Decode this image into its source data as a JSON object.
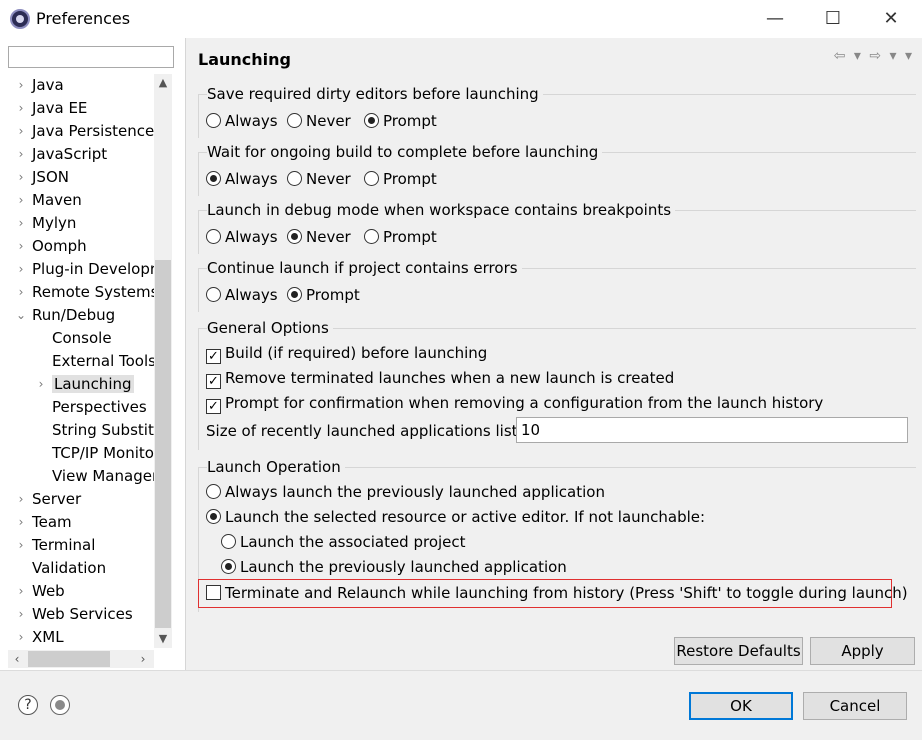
{
  "window": {
    "title": "Preferences",
    "minimize": "—",
    "maximize": "☐",
    "close": "✕"
  },
  "sidebar": {
    "filter_value": "",
    "items": [
      {
        "label": "Java",
        "arrow": "›"
      },
      {
        "label": "Java EE",
        "arrow": "›"
      },
      {
        "label": "Java Persistence",
        "arrow": "›"
      },
      {
        "label": "JavaScript",
        "arrow": "›"
      },
      {
        "label": "JSON",
        "arrow": "›"
      },
      {
        "label": "Maven",
        "arrow": "›"
      },
      {
        "label": "Mylyn",
        "arrow": "›"
      },
      {
        "label": "Oomph",
        "arrow": "›"
      },
      {
        "label": "Plug-in Developr",
        "arrow": "›"
      },
      {
        "label": "Remote Systems",
        "arrow": "›"
      },
      {
        "label": "Run/Debug",
        "arrow": "⌄"
      },
      {
        "label": "Console",
        "arrow": ""
      },
      {
        "label": "External Tools",
        "arrow": ""
      },
      {
        "label": "Launching",
        "arrow": "›"
      },
      {
        "label": "Perspectives",
        "arrow": ""
      },
      {
        "label": "String Substitu",
        "arrow": ""
      },
      {
        "label": "TCP/IP Monito",
        "arrow": ""
      },
      {
        "label": "View Manager",
        "arrow": ""
      },
      {
        "label": "Server",
        "arrow": "›"
      },
      {
        "label": "Team",
        "arrow": "›"
      },
      {
        "label": "Terminal",
        "arrow": "›"
      },
      {
        "label": "Validation",
        "arrow": ""
      },
      {
        "label": "Web",
        "arrow": "›"
      },
      {
        "label": "Web Services",
        "arrow": "›"
      },
      {
        "label": "XML",
        "arrow": "›"
      }
    ],
    "selected": "Launching"
  },
  "page": {
    "title": "Launching",
    "nav": "⇦ ▾  ⇨ ▾  ▾",
    "groups": {
      "save_dirty": {
        "label": "Save required dirty editors before launching",
        "options": [
          "Always",
          "Never",
          "Prompt"
        ],
        "selected": "Prompt"
      },
      "wait_build": {
        "label": "Wait for ongoing build to complete before launching",
        "options": [
          "Always",
          "Never",
          "Prompt"
        ],
        "selected": "Always"
      },
      "debug_mode": {
        "label": "Launch in debug mode when workspace contains breakpoints",
        "options": [
          "Always",
          "Never",
          "Prompt"
        ],
        "selected": "Never"
      },
      "continue_errors": {
        "label": "Continue launch if project contains errors",
        "options": [
          "Always",
          "Prompt"
        ],
        "selected": "Prompt"
      },
      "general": {
        "label": "General Options",
        "build": "Build (if required) before launching",
        "remove_terminated": "Remove terminated launches when a new launch is created",
        "prompt_confirm": "Prompt for confirmation when removing a configuration from the launch history",
        "size_label": "Size of recently launched applications list:",
        "size_value": "10"
      },
      "launch_operation": {
        "label": "Launch Operation",
        "always_previous": "Always launch the previously launched application",
        "launch_selected": "Launch the selected resource or active editor. If not launchable:",
        "associated_project": "Launch the associated project",
        "previous_app": "Launch the previously launched application",
        "terminate_relaunch": "Terminate and Relaunch while launching from history (Press 'Shift' to toggle during launch)"
      }
    },
    "restore_defaults": "Restore Defaults",
    "apply": "Apply"
  },
  "footer": {
    "ok": "OK",
    "cancel": "Cancel",
    "help_glyph": "?"
  }
}
